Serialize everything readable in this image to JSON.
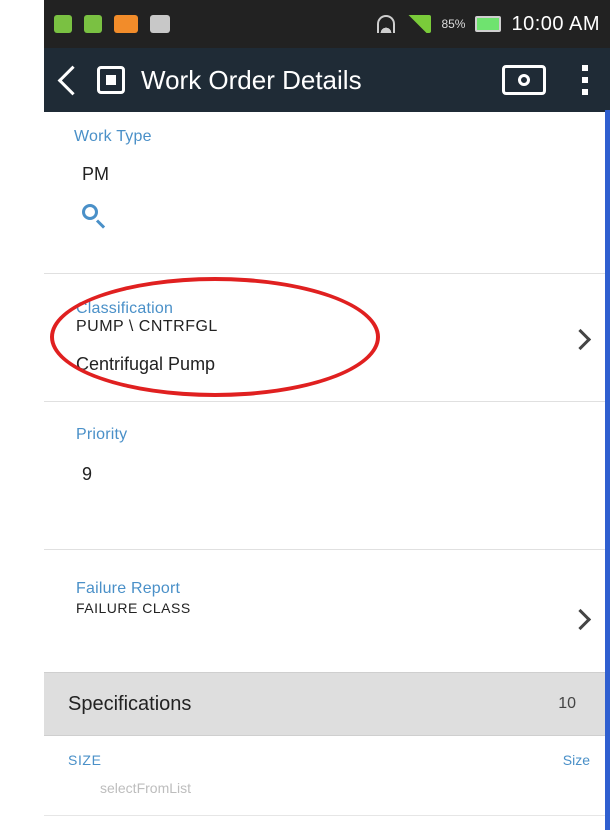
{
  "status_bar": {
    "battery_percent": "85%",
    "time": "10:00 AM"
  },
  "header": {
    "title": "Work Order Details"
  },
  "fields": {
    "work_type_label": "Work Type",
    "work_type_value": "PM",
    "classification_label": "Classification",
    "classification_path": "PUMP \\ CNTRFGL",
    "classification_description": "Centrifugal Pump",
    "priority_label": "Priority",
    "priority_value": "9",
    "failure_report_label": "Failure Report",
    "failure_report_value": "FAILURE CLASS"
  },
  "specifications": {
    "title": "Specifications",
    "count": "10",
    "size_label": "SIZE",
    "size_right_label": "Size",
    "select_placeholder": "selectFromList"
  },
  "icons": {
    "search": "search-icon",
    "camera": "camera-icon",
    "overflow": "overflow-icon",
    "back": "back-icon",
    "chevron": "chevron-right-icon"
  },
  "colors": {
    "header_bg": "#1f2b36",
    "status_bg": "#222222",
    "accent_blue": "#4a90c8",
    "highlight_red": "#e02020",
    "section_header_bg": "#dedede"
  }
}
